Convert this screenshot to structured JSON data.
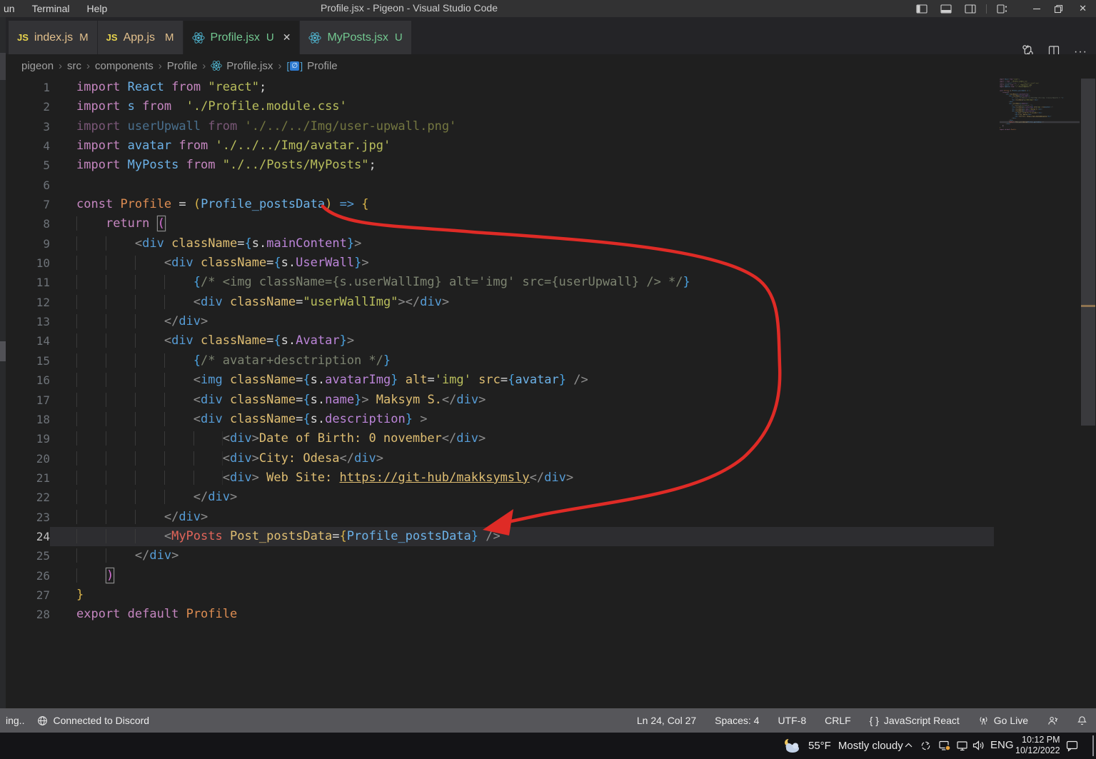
{
  "titlebar": {
    "menus": [
      "un",
      "Terminal",
      "Help"
    ],
    "title": "Profile.jsx - Pigeon - Visual Studio Code"
  },
  "tabs": [
    {
      "label": "index.js",
      "git": "M",
      "icon": "js-icon",
      "active": false
    },
    {
      "label": "App.js",
      "git": "M",
      "icon": "js-icon",
      "active": false
    },
    {
      "label": "Profile.jsx",
      "git": "U",
      "icon": "react-icon",
      "active": true
    },
    {
      "label": "MyPosts.jsx",
      "git": "U",
      "icon": "react-icon",
      "active": false
    }
  ],
  "breadcrumb": {
    "items": [
      "pigeon",
      "src",
      "components",
      "Profile"
    ],
    "file": "Profile.jsx",
    "symbol": "Profile"
  },
  "editor": {
    "current_line": 24,
    "palette": {
      "kw": "#C586C0",
      "id": "#6CB2E8",
      "fn": "#DE8D52",
      "pl": "#D4D4D4",
      "op": "#569CD6",
      "str": "#B9BE5C",
      "ag": "#8F8F8F",
      "tag": "#569CD6",
      "attr": "#DFBE72",
      "b1": "#D9B44A",
      "b2": "#D670D6",
      "b3": "#4AA2E0",
      "vr": "#D8D8D8",
      "prop": "#BC85D9",
      "cmt": "#7D8471",
      "txt": "#DFBE72",
      "lnk": "#DFBE72",
      "cmp": "#E2655A"
    },
    "lines": [
      {
        "n": 1,
        "dim": false,
        "tokens": [
          [
            "kw",
            "import"
          ],
          [
            "pl",
            " "
          ],
          [
            "id",
            "React"
          ],
          [
            "pl",
            " "
          ],
          [
            "kw",
            "from"
          ],
          [
            "pl",
            " "
          ],
          [
            "str",
            "\"react\""
          ],
          [
            "pl",
            ";"
          ]
        ]
      },
      {
        "n": 2,
        "dim": false,
        "tokens": [
          [
            "kw",
            "import"
          ],
          [
            "pl",
            " "
          ],
          [
            "id",
            "s"
          ],
          [
            "pl",
            " "
          ],
          [
            "kw",
            "from"
          ],
          [
            "pl",
            "  "
          ],
          [
            "str",
            "'./Profile.module.css'"
          ]
        ]
      },
      {
        "n": 3,
        "dim": true,
        "tokens": [
          [
            "kw",
            "import"
          ],
          [
            "pl",
            " "
          ],
          [
            "id",
            "userUpwall"
          ],
          [
            "pl",
            " "
          ],
          [
            "kw",
            "from"
          ],
          [
            "pl",
            " "
          ],
          [
            "str",
            "'./../../Img/user-upwall.png'"
          ]
        ]
      },
      {
        "n": 4,
        "dim": false,
        "tokens": [
          [
            "kw",
            "import"
          ],
          [
            "pl",
            " "
          ],
          [
            "id",
            "avatar"
          ],
          [
            "pl",
            " "
          ],
          [
            "kw",
            "from"
          ],
          [
            "pl",
            " "
          ],
          [
            "str",
            "'./../../Img/avatar.jpg'"
          ]
        ]
      },
      {
        "n": 5,
        "dim": false,
        "tokens": [
          [
            "kw",
            "import"
          ],
          [
            "pl",
            " "
          ],
          [
            "id",
            "MyPosts"
          ],
          [
            "pl",
            " "
          ],
          [
            "kw",
            "from"
          ],
          [
            "pl",
            " "
          ],
          [
            "str",
            "\"./../Posts/MyPosts\""
          ],
          [
            "pl",
            ";"
          ]
        ]
      },
      {
        "n": 6,
        "dim": false,
        "tokens": []
      },
      {
        "n": 7,
        "dim": false,
        "tokens": [
          [
            "kw",
            "const"
          ],
          [
            "pl",
            " "
          ],
          [
            "fn",
            "Profile"
          ],
          [
            "pl",
            " = "
          ],
          [
            "b1",
            "("
          ],
          [
            "id",
            "Profile_postsData"
          ],
          [
            "b1",
            ")"
          ],
          [
            "pl",
            " "
          ],
          [
            "op",
            "=>"
          ],
          [
            "pl",
            " "
          ],
          [
            "b1",
            "{"
          ]
        ]
      },
      {
        "n": 8,
        "dim": false,
        "tokens": [
          [
            "ind",
            "    "
          ],
          [
            "kw",
            "return"
          ],
          [
            "pl",
            " "
          ],
          [
            "b2",
            "("
          ]
        ]
      },
      {
        "n": 9,
        "dim": false,
        "tokens": [
          [
            "ind",
            "        "
          ],
          [
            "ag",
            "<"
          ],
          [
            "tag",
            "div"
          ],
          [
            "pl",
            " "
          ],
          [
            "attr",
            "className"
          ],
          [
            "pl",
            "="
          ],
          [
            "b3",
            "{"
          ],
          [
            "vr",
            "s"
          ],
          [
            "pl",
            "."
          ],
          [
            "prop",
            "mainContent"
          ],
          [
            "b3",
            "}"
          ],
          [
            "ag",
            ">"
          ]
        ]
      },
      {
        "n": 10,
        "dim": false,
        "tokens": [
          [
            "ind",
            "            "
          ],
          [
            "ag",
            "<"
          ],
          [
            "tag",
            "div"
          ],
          [
            "pl",
            " "
          ],
          [
            "attr",
            "className"
          ],
          [
            "pl",
            "="
          ],
          [
            "b3",
            "{"
          ],
          [
            "vr",
            "s"
          ],
          [
            "pl",
            "."
          ],
          [
            "prop",
            "UserWall"
          ],
          [
            "b3",
            "}"
          ],
          [
            "ag",
            ">"
          ]
        ]
      },
      {
        "n": 11,
        "dim": false,
        "tokens": [
          [
            "ind",
            "                "
          ],
          [
            "b3",
            "{"
          ],
          [
            "cmt",
            "/* <img className={s.userWallImg} alt='img' src={userUpwall} /> */"
          ],
          [
            "b3",
            "}"
          ]
        ]
      },
      {
        "n": 12,
        "dim": false,
        "tokens": [
          [
            "ind",
            "                "
          ],
          [
            "ag",
            "<"
          ],
          [
            "tag",
            "div"
          ],
          [
            "pl",
            " "
          ],
          [
            "attr",
            "className"
          ],
          [
            "pl",
            "="
          ],
          [
            "str",
            "\"userWallImg\""
          ],
          [
            "ag",
            ">"
          ],
          [
            "ag",
            "</"
          ],
          [
            "tag",
            "div"
          ],
          [
            "ag",
            ">"
          ]
        ]
      },
      {
        "n": 13,
        "dim": false,
        "tokens": [
          [
            "ind",
            "            "
          ],
          [
            "ag",
            "</"
          ],
          [
            "tag",
            "div"
          ],
          [
            "ag",
            ">"
          ]
        ]
      },
      {
        "n": 14,
        "dim": false,
        "tokens": [
          [
            "ind",
            "            "
          ],
          [
            "ag",
            "<"
          ],
          [
            "tag",
            "div"
          ],
          [
            "pl",
            " "
          ],
          [
            "attr",
            "className"
          ],
          [
            "pl",
            "="
          ],
          [
            "b3",
            "{"
          ],
          [
            "vr",
            "s"
          ],
          [
            "pl",
            "."
          ],
          [
            "prop",
            "Avatar"
          ],
          [
            "b3",
            "}"
          ],
          [
            "ag",
            ">"
          ]
        ]
      },
      {
        "n": 15,
        "dim": false,
        "tokens": [
          [
            "ind",
            "                "
          ],
          [
            "b3",
            "{"
          ],
          [
            "cmt",
            "/* avatar+desctription */"
          ],
          [
            "b3",
            "}"
          ]
        ]
      },
      {
        "n": 16,
        "dim": false,
        "tokens": [
          [
            "ind",
            "                "
          ],
          [
            "ag",
            "<"
          ],
          [
            "tag",
            "img"
          ],
          [
            "pl",
            " "
          ],
          [
            "attr",
            "className"
          ],
          [
            "pl",
            "="
          ],
          [
            "b3",
            "{"
          ],
          [
            "vr",
            "s"
          ],
          [
            "pl",
            "."
          ],
          [
            "prop",
            "avatarImg"
          ],
          [
            "b3",
            "}"
          ],
          [
            "pl",
            " "
          ],
          [
            "attr",
            "alt"
          ],
          [
            "pl",
            "="
          ],
          [
            "str",
            "'img'"
          ],
          [
            "pl",
            " "
          ],
          [
            "attr",
            "src"
          ],
          [
            "pl",
            "="
          ],
          [
            "b3",
            "{"
          ],
          [
            "id",
            "avatar"
          ],
          [
            "b3",
            "}"
          ],
          [
            "pl",
            " "
          ],
          [
            "ag",
            "/>"
          ]
        ]
      },
      {
        "n": 17,
        "dim": false,
        "tokens": [
          [
            "ind",
            "                "
          ],
          [
            "ag",
            "<"
          ],
          [
            "tag",
            "div"
          ],
          [
            "pl",
            " "
          ],
          [
            "attr",
            "className"
          ],
          [
            "pl",
            "="
          ],
          [
            "b3",
            "{"
          ],
          [
            "vr",
            "s"
          ],
          [
            "pl",
            "."
          ],
          [
            "prop",
            "name"
          ],
          [
            "b3",
            "}"
          ],
          [
            "ag",
            ">"
          ],
          [
            "txt",
            " Maksym S."
          ],
          [
            "ag",
            "</"
          ],
          [
            "tag",
            "div"
          ],
          [
            "ag",
            ">"
          ]
        ]
      },
      {
        "n": 18,
        "dim": false,
        "tokens": [
          [
            "ind",
            "                "
          ],
          [
            "ag",
            "<"
          ],
          [
            "tag",
            "div"
          ],
          [
            "pl",
            " "
          ],
          [
            "attr",
            "className"
          ],
          [
            "pl",
            "="
          ],
          [
            "b3",
            "{"
          ],
          [
            "vr",
            "s"
          ],
          [
            "pl",
            "."
          ],
          [
            "prop",
            "description"
          ],
          [
            "b3",
            "}"
          ],
          [
            "pl",
            " "
          ],
          [
            "ag",
            ">"
          ]
        ]
      },
      {
        "n": 19,
        "dim": false,
        "tokens": [
          [
            "ind",
            "                    "
          ],
          [
            "ag",
            "<"
          ],
          [
            "tag",
            "div"
          ],
          [
            "ag",
            ">"
          ],
          [
            "txt",
            "Date of Birth: 0 november"
          ],
          [
            "ag",
            "</"
          ],
          [
            "tag",
            "div"
          ],
          [
            "ag",
            ">"
          ]
        ]
      },
      {
        "n": 20,
        "dim": false,
        "tokens": [
          [
            "ind",
            "                    "
          ],
          [
            "ag",
            "<"
          ],
          [
            "tag",
            "div"
          ],
          [
            "ag",
            ">"
          ],
          [
            "txt",
            "City: Odesa"
          ],
          [
            "ag",
            "</"
          ],
          [
            "tag",
            "div"
          ],
          [
            "ag",
            ">"
          ]
        ]
      },
      {
        "n": 21,
        "dim": false,
        "tokens": [
          [
            "ind",
            "                    "
          ],
          [
            "ag",
            "<"
          ],
          [
            "tag",
            "div"
          ],
          [
            "ag",
            ">"
          ],
          [
            "txt",
            " Web Site: "
          ],
          [
            "lnk",
            "https://git-hub/makksymsly"
          ],
          [
            "ag",
            "</"
          ],
          [
            "tag",
            "div"
          ],
          [
            "ag",
            ">"
          ]
        ]
      },
      {
        "n": 22,
        "dim": false,
        "tokens": [
          [
            "ind",
            "                "
          ],
          [
            "ag",
            "</"
          ],
          [
            "tag",
            "div"
          ],
          [
            "ag",
            ">"
          ]
        ]
      },
      {
        "n": 23,
        "dim": false,
        "tokens": [
          [
            "ind",
            "            "
          ],
          [
            "ag",
            "</"
          ],
          [
            "tag",
            "div"
          ],
          [
            "ag",
            ">"
          ]
        ]
      },
      {
        "n": 24,
        "dim": false,
        "tokens": [
          [
            "ind",
            "            "
          ],
          [
            "ag",
            "<"
          ],
          [
            "cmp",
            "MyPosts"
          ],
          [
            "pl",
            " "
          ],
          [
            "attr",
            "Post_postsData"
          ],
          [
            "pl",
            "="
          ],
          [
            "b1",
            "{"
          ],
          [
            "id",
            "Profile_postsData"
          ],
          [
            "b3",
            "}"
          ],
          [
            "pl",
            " "
          ],
          [
            "ag",
            "/>"
          ]
        ]
      },
      {
        "n": 25,
        "dim": false,
        "tokens": [
          [
            "ind",
            "        "
          ],
          [
            "ag",
            "</"
          ],
          [
            "tag",
            "div"
          ],
          [
            "ag",
            ">"
          ]
        ]
      },
      {
        "n": 26,
        "dim": false,
        "tokens": [
          [
            "ind",
            "    "
          ],
          [
            "b2",
            ")"
          ]
        ]
      },
      {
        "n": 27,
        "dim": false,
        "tokens": [
          [
            "b1",
            "}"
          ]
        ]
      },
      {
        "n": 28,
        "dim": false,
        "tokens": [
          [
            "kw",
            "export"
          ],
          [
            "pl",
            " "
          ],
          [
            "kw",
            "default"
          ],
          [
            "pl",
            " "
          ],
          [
            "fn",
            "Profile"
          ]
        ]
      }
    ]
  },
  "status_bar": {
    "left_fragment": "ing..",
    "remote": "Connected to Discord",
    "cursor": "Ln 24, Col 27",
    "indent": "Spaces: 4",
    "encoding": "UTF-8",
    "eol": "CRLF",
    "language": "JavaScript React",
    "go_live": "Go Live"
  },
  "taskbar": {
    "temp": "55°F",
    "condition": "Mostly cloudy",
    "language": "ENG",
    "time": "10:12 PM",
    "date": "10/12/2022"
  },
  "colors": {
    "arrow_annotation": "#DF2B26",
    "git_modified": "#E2C08D",
    "git_untracked": "#73C991",
    "react_icon": "#53C1DE",
    "js_icon": "#E8D44D",
    "statusbar_bg": "#56565A",
    "taskbar_bg": "#141417",
    "editor_bg": "#1F1F1F",
    "current_line_bg": "#2D2D30"
  }
}
